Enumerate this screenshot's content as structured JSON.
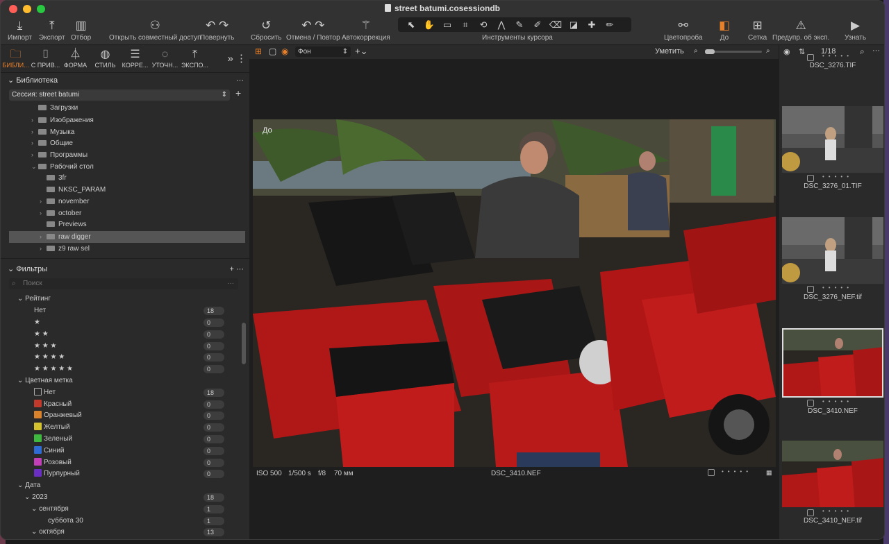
{
  "window": {
    "title": "street batumi.cosessiondb"
  },
  "toolbar": {
    "import": "Импорт",
    "export": "Экспорт",
    "cull": "Отбор",
    "share": "Открыть совместный доступ",
    "rotate": "Повернуть",
    "reset": "Сбросить",
    "undo_redo": "Отмена / Повтор",
    "autocorrect": "Автокоррекция",
    "cursor_tools": "Инструменты курсора",
    "color_probe": "Цветопроба",
    "before": "До",
    "grid": "Сетка",
    "exposure_warning": "Предупр. об эксп.",
    "learn": "Узнать"
  },
  "tool_tabs": [
    {
      "label": "БИБЛИ...",
      "icon": "folder-icon",
      "active": true
    },
    {
      "label": "С ПРИВ...",
      "icon": "camera-icon"
    },
    {
      "label": "ФОРМА",
      "icon": "lens-icon"
    },
    {
      "label": "СТИЛЬ",
      "icon": "palette-icon"
    },
    {
      "label": "КОРРЕ...",
      "icon": "sliders-icon"
    },
    {
      "label": "УТОЧН...",
      "icon": "dial-icon"
    },
    {
      "label": "ЭКСПО...",
      "icon": "export-icon"
    }
  ],
  "library": {
    "title": "Библиотека",
    "session": "Сессия: street batumi",
    "items": [
      {
        "label": "Загрузки",
        "indent": 1,
        "arrow": ""
      },
      {
        "label": "Изображения",
        "indent": 1,
        "arrow": "›"
      },
      {
        "label": "Музыка",
        "indent": 1,
        "arrow": "›"
      },
      {
        "label": "Общие",
        "indent": 1,
        "arrow": "›"
      },
      {
        "label": "Программы",
        "indent": 1,
        "arrow": "›"
      },
      {
        "label": "Рабочий стол",
        "indent": 1,
        "arrow": "⌄"
      },
      {
        "label": "3fr",
        "indent": 2,
        "arrow": ""
      },
      {
        "label": "NKSC_PARAM",
        "indent": 2,
        "arrow": ""
      },
      {
        "label": "november",
        "indent": 2,
        "arrow": "›"
      },
      {
        "label": "october",
        "indent": 2,
        "arrow": "›"
      },
      {
        "label": "Previews",
        "indent": 2,
        "arrow": ""
      },
      {
        "label": "raw digger",
        "indent": 2,
        "arrow": "›",
        "selected": true
      },
      {
        "label": "z9 raw sel",
        "indent": 2,
        "arrow": "›"
      }
    ]
  },
  "filters": {
    "title": "Фильтры",
    "search_placeholder": "Поиск",
    "rating_title": "Рейтинг",
    "ratings": [
      {
        "label": "Нет",
        "count": "18"
      },
      {
        "label": "★",
        "count": "0"
      },
      {
        "label": "★ ★",
        "count": "0"
      },
      {
        "label": "★ ★ ★",
        "count": "0"
      },
      {
        "label": "★ ★ ★ ★",
        "count": "0"
      },
      {
        "label": "★ ★ ★ ★ ★",
        "count": "0"
      }
    ],
    "color_title": "Цветная метка",
    "colors": [
      {
        "label": "Нет",
        "count": "18",
        "color": "none"
      },
      {
        "label": "Красный",
        "count": "0",
        "color": "#c0392b"
      },
      {
        "label": "Оранжевый",
        "count": "0",
        "color": "#d9822b"
      },
      {
        "label": "Желтый",
        "count": "0",
        "color": "#d4c22e"
      },
      {
        "label": "Зеленый",
        "count": "0",
        "color": "#3fb83f"
      },
      {
        "label": "Синий",
        "count": "0",
        "color": "#2e6bd4"
      },
      {
        "label": "Розовый",
        "count": "0",
        "color": "#c23fb8"
      },
      {
        "label": "Пурпурный",
        "count": "0",
        "color": "#6b2ec2"
      }
    ],
    "date_title": "Дата",
    "dates": [
      {
        "label": "2023",
        "count": "18",
        "level": 1
      },
      {
        "label": "сентября",
        "count": "1",
        "level": 2
      },
      {
        "label": "суббота 30",
        "count": "1",
        "level": 3
      },
      {
        "label": "октября",
        "count": "13",
        "level": 2
      }
    ]
  },
  "viewer": {
    "mode": "Фон",
    "fit": "Уметить",
    "overlay": "До",
    "iso": "ISO 500",
    "shutter": "1/500 s",
    "aperture": "f/8",
    "focal": "70 мм",
    "filename": "DSC_3410.NEF"
  },
  "browser": {
    "counter": "1/18",
    "thumbs": [
      {
        "name": "DSC_3276.TIF",
        "partial": true
      },
      {
        "name": "DSC_3276_01.TIF"
      },
      {
        "name": "DSC_3276_NEF.tif"
      },
      {
        "name": "DSC_3410.NEF",
        "selected": true
      },
      {
        "name": "DSC_3410_NEF.tif"
      }
    ]
  }
}
